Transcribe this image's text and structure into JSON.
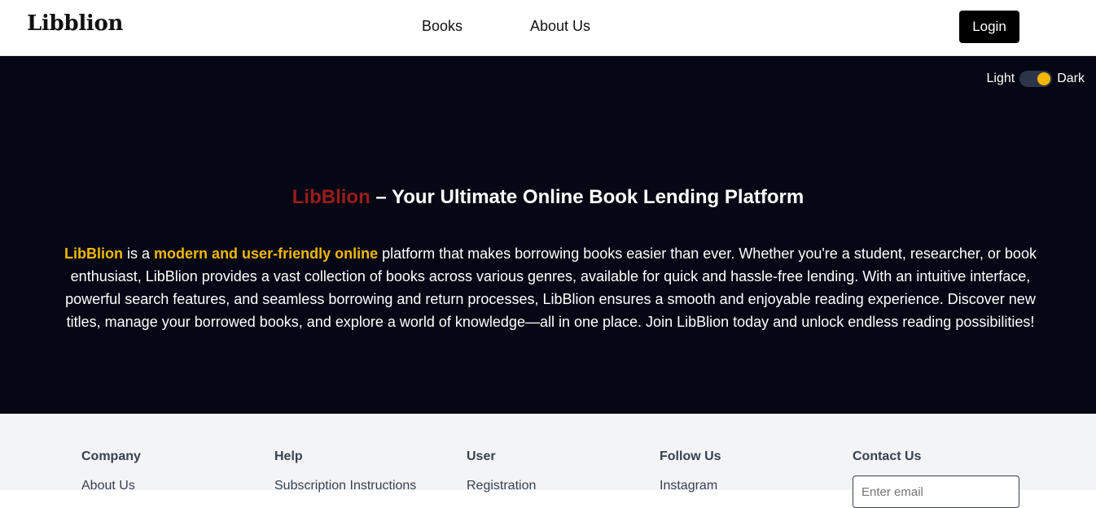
{
  "header": {
    "logo": "Libblion",
    "nav": {
      "books": "Books",
      "about": "About Us"
    },
    "login_label": "Login"
  },
  "theme_toggle": {
    "light_label": "Light",
    "dark_label": "Dark",
    "selected": "dark",
    "accent_color": "#f2b705"
  },
  "hero": {
    "title_brand": "LibBlion",
    "title_rest": " – Your Ultimate Online Book Lending Platform",
    "desc_brand": "LibBlion",
    "desc_is_a": " is a ",
    "desc_highlight": "modern and user-friendly online",
    "desc_rest": " platform that makes borrowing books easier than ever. Whether you're a student, researcher, or book enthusiast, LibBlion provides a vast collection of books across various genres, available for quick and hassle-free lending. With an intuitive interface, powerful search features, and seamless borrowing and return processes, LibBlion ensures a smooth and enjoyable reading experience. Discover new titles, manage your borrowed books, and explore a world of knowledge—all in one place. Join LibBlion today and unlock endless reading possibilities!"
  },
  "footer": {
    "company": {
      "heading": "Company",
      "links": [
        "About Us"
      ]
    },
    "help": {
      "heading": "Help",
      "links": [
        "Subscription Instructions"
      ]
    },
    "user": {
      "heading": "User",
      "links": [
        "Registration"
      ]
    },
    "follow": {
      "heading": "Follow Us",
      "links": [
        "Instagram"
      ]
    },
    "contact": {
      "heading": "Contact Us",
      "email_placeholder": "Enter email"
    }
  },
  "colors": {
    "hero_bg": "#050814",
    "brand_red": "#9b1c1c",
    "highlight_yellow": "#f2b705",
    "footer_bg": "#f3f4f6"
  }
}
